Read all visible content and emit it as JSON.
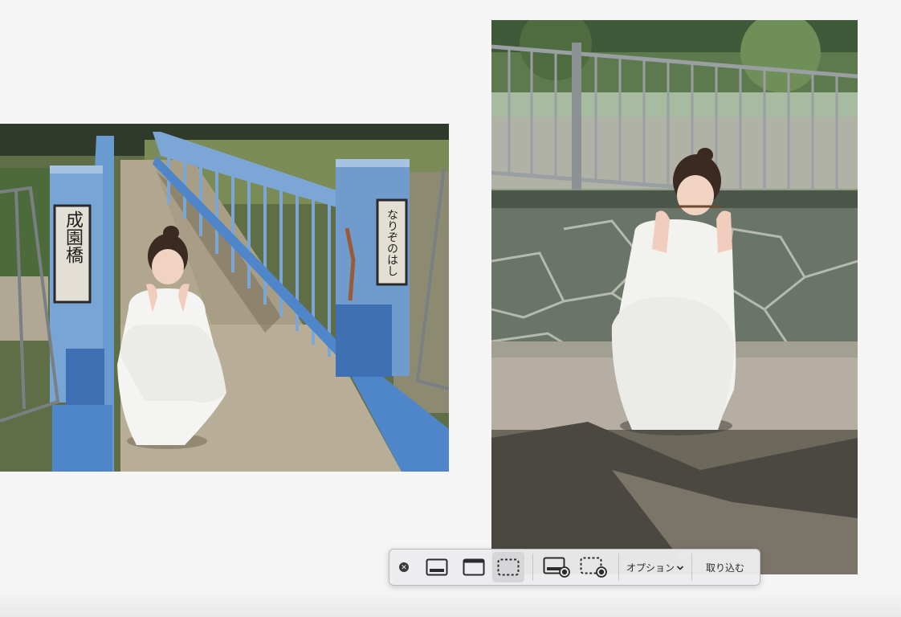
{
  "photos": {
    "left": {
      "sign_left": "成園橋",
      "sign_right": "なりぞのはし"
    }
  },
  "toolbar": {
    "options_label": "オプション",
    "capture_label": "取り込む",
    "icons": [
      "close-icon",
      "capture-entire-screen-icon",
      "capture-window-icon",
      "capture-selection-icon",
      "record-screen-icon",
      "record-selection-icon",
      "chevron-down-icon"
    ]
  },
  "colors": {
    "background": "#f5f5f6",
    "toolbar": "#ececee",
    "bridge_blue": "#6f9ccd"
  }
}
